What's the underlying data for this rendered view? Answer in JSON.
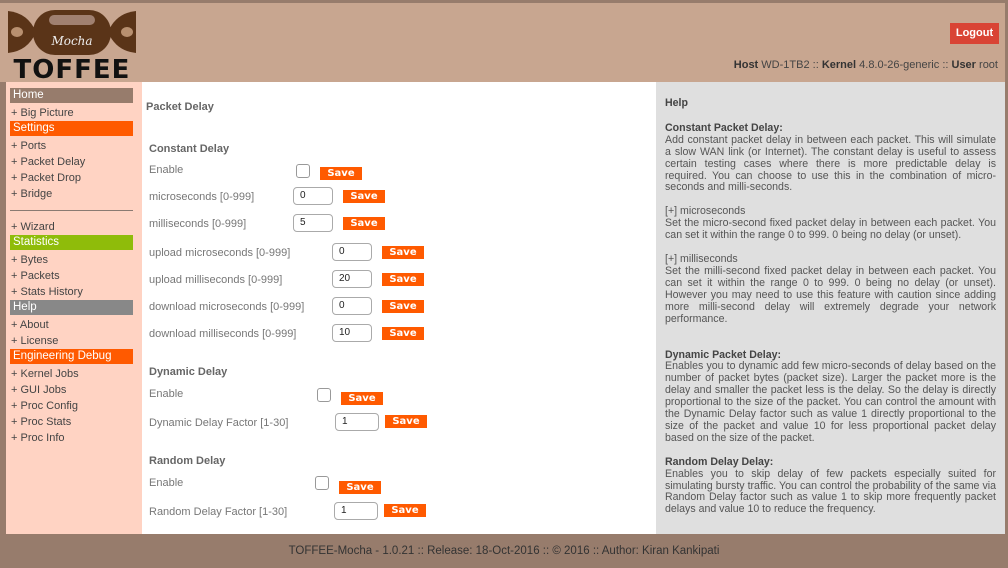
{
  "header": {
    "logo_script": "Mocha",
    "logo_title": "TOFFEE",
    "logout_label": "Logout",
    "host_label": "Host",
    "host_value": "WD-1TB2",
    "sep1": "::",
    "kernel_label": "Kernel",
    "kernel_value": "4.8.0-26-generic",
    "sep2": "::",
    "user_label": "User",
    "user_value": "root"
  },
  "sidebar": {
    "sections": [
      {
        "title": "Home",
        "color": "#977c6c",
        "items": [
          "+ Big Picture"
        ]
      },
      {
        "title": "Settings",
        "color": "#ff5a00",
        "items": [
          "+ Ports",
          "+ Packet Delay",
          "+ Packet Drop",
          "+ Bridge"
        ],
        "after_divider": [
          "+ Wizard"
        ]
      },
      {
        "title": "Statistics",
        "color": "#8fbc0a",
        "items": [
          "+ Bytes",
          "+ Packets",
          "+ Stats History"
        ]
      },
      {
        "title": "Help",
        "color": "#888888",
        "items": [
          "+ About",
          "+ License"
        ]
      },
      {
        "title": "Engineering Debug",
        "color": "#ff5a00",
        "items": [
          "+ Kernel Jobs",
          "+ GUI Jobs",
          "+ Proc Config",
          "+ Proc Stats",
          "+ Proc Info"
        ]
      }
    ]
  },
  "main": {
    "page_title": "Packet Delay",
    "save_label": "Save",
    "constant": {
      "title": "Constant Delay",
      "enable_label": "Enable",
      "enabled": false,
      "fields": [
        {
          "label": "microseconds [0-999]",
          "value": "0"
        },
        {
          "label": "milliseconds [0-999]",
          "value": "5"
        },
        {
          "label": "upload microseconds [0-999]",
          "value": "0"
        },
        {
          "label": "upload milliseconds [0-999]",
          "value": "20"
        },
        {
          "label": "download microseconds [0-999]",
          "value": "0"
        },
        {
          "label": "download milliseconds [0-999]",
          "value": "10"
        }
      ]
    },
    "dynamic": {
      "title": "Dynamic Delay",
      "enable_label": "Enable",
      "enabled": false,
      "factor_label": "Dynamic Delay Factor [1-30]",
      "factor_value": "1"
    },
    "random": {
      "title": "Random Delay",
      "enable_label": "Enable",
      "enabled": false,
      "factor_label": "Random Delay Factor [1-30]",
      "factor_value": "1"
    }
  },
  "help": {
    "title": "Help",
    "constant_head": "Constant Packet Delay:",
    "constant_text": "Add constant packet delay in between each packet. This will simulate a slow WAN link (or Internet). The constant delay is useful to assess certain testing cases where there is more predictable delay is required. You can choose to use this in the combination of micro-seconds and milli-seconds.",
    "micro_head": "[+] microseconds",
    "micro_text": "Set the micro-second fixed packet delay in between each packet. You can set it within the range 0 to 999. 0 being no delay (or unset).",
    "milli_head": "[+] milliseconds",
    "milli_text": "Set the milli-second fixed packet delay in between each packet. You can set it within the range 0 to 999. 0 being no delay (or unset). However you may need to use this feature with caution since adding more milli-second delay will extremely degrade your network performance.",
    "dynamic_head": "Dynamic Packet Delay:",
    "dynamic_text": "Enables you to dynamic add few micro-seconds of delay based on the number of packet bytes (packet size). Larger the packet more is the delay and smaller the packet less is the delay. So the delay is directly proportional to the size of the packet. You can control the amount with the Dynamic Delay factor such as value 1 directly proportional to the size of the packet and value 10 for less proportional packet delay based on the size of the packet.",
    "random_head": "Random Delay Delay:",
    "random_text": "Enables you to skip delay of few packets especially suited for simulating bursty traffic. You can control the probability of the same via Random Delay factor such as value 1 to skip more frequently packet delays and value 10 to reduce the frequency."
  },
  "footer": {
    "text": "TOFFEE-Mocha - 1.0.21 :: Release: 18-Oct-2016 :: © 2016 :: Author: Kiran Kankipati"
  },
  "colors": {
    "header_bg": "#c8a690",
    "frame_bg": "#977c6c",
    "sidebar_bg": "#ffd3c3",
    "help_bg": "#dfdfdf",
    "accent_orange": "#ff5a00",
    "logout_red": "#d94435"
  }
}
